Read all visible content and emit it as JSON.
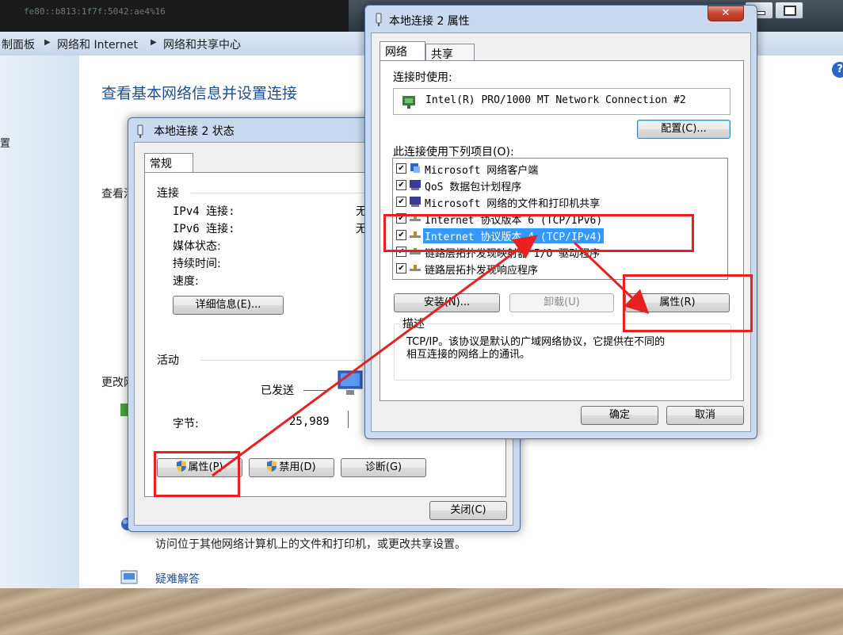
{
  "background": {
    "terminal_text": "fe80::b813:1f7f:5042:ae4%16",
    "breadcrumb": [
      "制面板",
      "网络和 Internet",
      "网络和共享中心"
    ],
    "heading": "查看基本网络信息并设置连接",
    "view_active_label": "查看活",
    "change_label": "更改网",
    "left_text": "置",
    "access_text": "访问位于其他网络计算机上的文件和打印机，或更改共享设置。",
    "troubleshoot": "疑难解答",
    "help_glyph": "?"
  },
  "status_dialog": {
    "title": "本地连接 2 状态",
    "tab": "常规",
    "connection_group": "连接",
    "ipv4_label": "IPv4 连接:",
    "ipv4_value": "无",
    "ipv6_label": "IPv6 连接:",
    "ipv6_value": "无",
    "media_label": "媒体状态:",
    "duration_label": "持续时间:",
    "speed_label": "速度:",
    "details_button": "详细信息(E)...",
    "activity_group": "活动",
    "sent_label": "已发送",
    "bytes_label": "字节:",
    "bytes_value": "25,989",
    "properties_button": "属性(P)",
    "disable_button": "禁用(D)",
    "diagnose_button": "诊断(G)",
    "close_button": "关闭(C)"
  },
  "properties_dialog": {
    "title": "本地连接 2 属性",
    "close_glyph": "✕",
    "tabs": [
      "网络",
      "共享"
    ],
    "connect_using_label": "连接时使用:",
    "adapter_name": "Intel(R) PRO/1000 MT Network Connection #2",
    "configure_button": "配置(C)...",
    "items_label": "此连接使用下列项目(O):",
    "items": [
      "Microsoft 网络客户端",
      "QoS 数据包计划程序",
      "Microsoft 网络的文件和打印机共享",
      "Internet 协议版本 6 (TCP/IPv6)",
      "Internet 协议版本 4 (TCP/IPv4)",
      "链路层拓扑发现映射器 I/O 驱动程序",
      "链路层拓扑发现响应程序"
    ],
    "check_glyph": "✔",
    "install_button": "安装(N)...",
    "uninstall_button": "卸载(U)",
    "properties_button": "属性(R)",
    "description_group": "描述",
    "description_text_1": "TCP/IP。该协议是默认的广域网络协议，它提供在不同的",
    "description_text_2": "相互连接的网络上的通讯。",
    "ok_button": "确定",
    "cancel_button": "取消"
  },
  "colors": {
    "annotation": "#e82020",
    "selection": "#3399ff",
    "heading": "#1f4f96"
  }
}
